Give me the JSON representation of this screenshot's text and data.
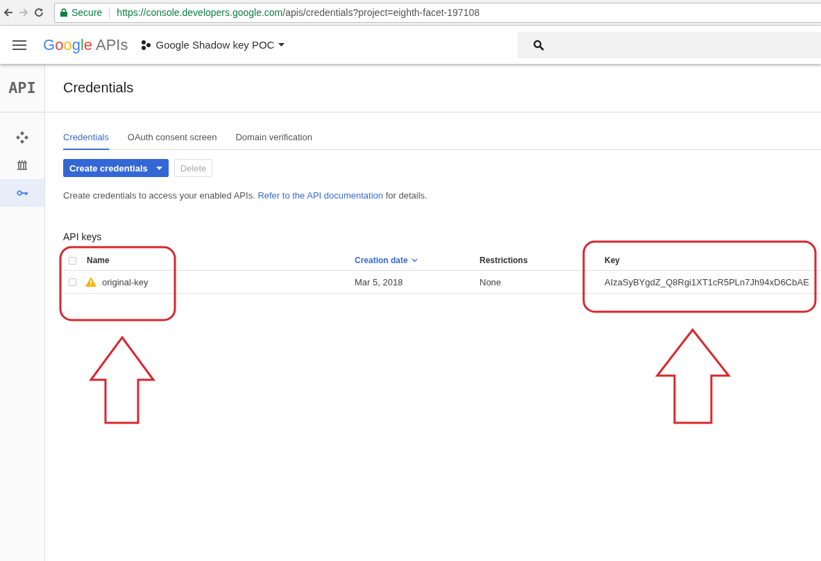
{
  "browser": {
    "secure_label": "Secure",
    "url_host": "https://console.developers.google.com",
    "url_path": "/apis/credentials?project=eighth-facet-197108"
  },
  "app_bar": {
    "logo_google": "Google",
    "logo_apis": "APIs",
    "project": "Google Shadow key POC"
  },
  "sidebar": {
    "logo": "API",
    "items": [
      {
        "kind": "dashboard",
        "selected": false
      },
      {
        "kind": "library",
        "selected": false
      },
      {
        "kind": "credentials",
        "selected": true
      }
    ]
  },
  "page": {
    "title": "Credentials",
    "tabs": [
      {
        "label": "Credentials",
        "selected": true
      },
      {
        "label": "OAuth consent screen",
        "selected": false
      },
      {
        "label": "Domain verification",
        "selected": false
      }
    ],
    "buttons": [
      {
        "label": "Create credentials",
        "kind": "primary",
        "disabled": false
      },
      {
        "label": "Delete",
        "kind": "secondary",
        "disabled": true
      }
    ],
    "intro": {
      "before": "Create credentials to access your enabled APIs.",
      "link": "Refer to the API documentation",
      "after": "for details."
    },
    "api_keys": {
      "title": "API keys",
      "select_all_checked": false,
      "columns": [
        {
          "label": "Name",
          "sorted": false
        },
        {
          "label": "Creation date",
          "sorted": true
        },
        {
          "label": "Restrictions",
          "sorted": false
        },
        {
          "label": "Key",
          "sorted": false
        }
      ],
      "rows": [
        {
          "checked": false,
          "warning": true,
          "name": "original-key",
          "creation_date": "Mar 5, 2018",
          "restrictions": "None",
          "key": "AIzaSyBYgdZ_Q8Rgi1XT1cR5PLn7Jh94xD6CbAE"
        }
      ]
    }
  }
}
